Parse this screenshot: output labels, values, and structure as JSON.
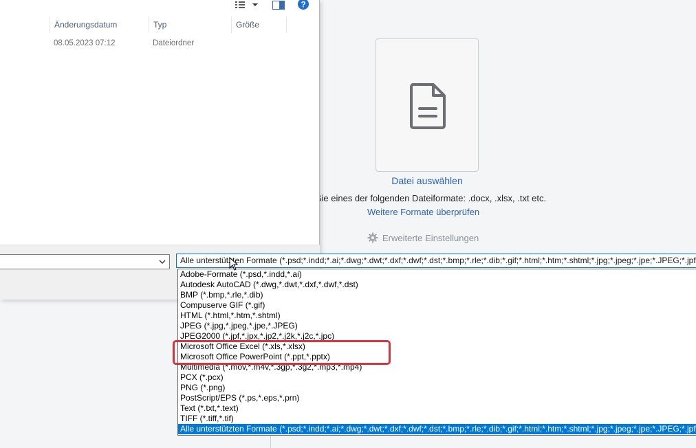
{
  "background": {
    "choose_file": "Datei auswählen",
    "formats_hint": "n Sie eines der folgenden Dateiformate: .docx, .xlsx, .txt etc.",
    "check_formats": "Weitere Formate überprüfen",
    "advanced_settings": "Erweiterte Einstellungen"
  },
  "dialog": {
    "columns": {
      "date": "Änderungsdatum",
      "type": "Typ",
      "size": "Größe"
    },
    "rows": [
      {
        "date": "08.05.2023 07:12",
        "type": "Dateiordner",
        "size": ""
      }
    ],
    "file_name_value": "",
    "file_type_selected": "Alle unterstützten Formate (*.psd;*.indd;*.ai;*.dwg;*.dwt;*.dxf;*.dwf;*.dst;*.bmp;*.rle;*.dib;*.gif;*.html;*.htm;*.shtml;*.jpg;*.jpeg;*.jpe;*.JPEG;*.jpf;*.jpx;*.jp2;*.j2k;*.j2c;*.jpc;*.xls;*.xlsx;*.ppt;*.pptx)"
  },
  "dropdown": {
    "options": [
      "Adobe-Formate (*.psd,*.indd,*.ai)",
      "Autodesk AutoCAD (*.dwg,*.dwt,*.dxf,*.dwf,*.dst)",
      "BMP (*.bmp,*.rle,*.dib)",
      "Compuserve GIF (*.gif)",
      "HTML (*.html,*.htm,*.shtml)",
      "JPEG (*.jpg,*.jpeg,*.jpe,*.JPEG)",
      "JPEG2000 (*.jpf,*.jpx,*.jp2,*.j2k,*.j2c,*.jpc)",
      "Microsoft Office Excel (*.xls,*.xlsx)",
      "Microsoft Office PowerPoint (*.ppt,*.pptx)",
      "Multimedia (*.mov,*.m4v,*.3gp,*.3g2,*.mp3,*.mp4)",
      "PCX (*.pcx)",
      "PNG (*.png)",
      "PostScript/EPS (*.ps,*.eps,*.prn)",
      "Text (*.txt,*.text)",
      "TIFF (*.tiff,*.tif)",
      "Alle unterstützten Formate (*.psd;*.indd;*.ai;*.dwg;*.dwt;*.dxf;*.dwf;*.dst;*.bmp;*.rle;*.dib;*.gif;*.html;*.htm;*.shtml;*.jpg;*.jpeg;*.jpe;*.JPEG;*.jpf;*.jpx;*.jp2;*.j2k;*.j2c;*.jpc)"
    ],
    "selected_index": 15,
    "highlighted": [
      "Microsoft Office Excel (*.xls,*.xlsx)",
      "Microsoft Office PowerPoint (*.ppt,*.pptx)"
    ]
  },
  "colors": {
    "accent": "#0078d7",
    "link": "#2b63b8",
    "highlight_box": "#d9333f"
  },
  "icons": [
    "document-icon",
    "view-options-icon",
    "dropdown-arrow-icon",
    "preview-pane-icon",
    "help-icon",
    "gear-icon",
    "chevron-down-icon",
    "mouse-cursor-icon"
  ]
}
